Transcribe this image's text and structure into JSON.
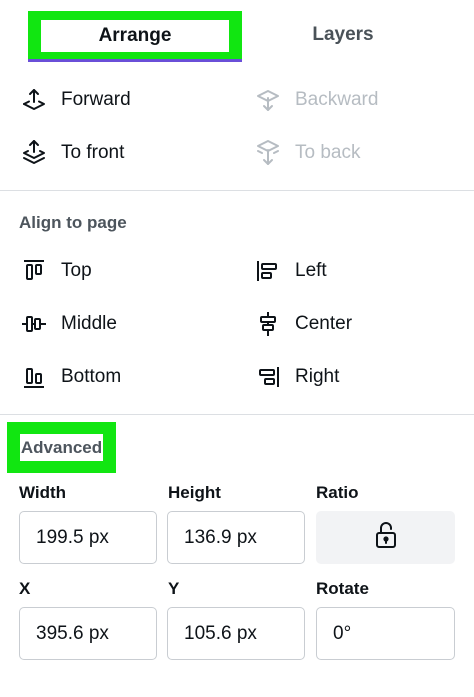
{
  "tabs": [
    {
      "label": "Arrange"
    },
    {
      "label": "Layers"
    }
  ],
  "order": {
    "forward": "Forward",
    "backward": "Backward",
    "to_front": "To front",
    "to_back": "To back"
  },
  "align": {
    "section_label": "Align to page",
    "top": "Top",
    "left": "Left",
    "middle": "Middle",
    "center": "Center",
    "bottom": "Bottom",
    "right": "Right"
  },
  "advanced": {
    "section_label": "Advanced",
    "width": {
      "label": "Width",
      "value": "199.5 px"
    },
    "height": {
      "label": "Height",
      "value": "136.9 px"
    },
    "ratio": {
      "label": "Ratio",
      "icon": "lock-open-icon"
    },
    "x": {
      "label": "X",
      "value": "395.6 px"
    },
    "y": {
      "label": "Y",
      "value": "105.6 px"
    },
    "rotate": {
      "label": "Rotate",
      "value": "0°"
    }
  },
  "colors": {
    "highlight": "#11e611",
    "active_tab_underline": "#6a4fd8",
    "disabled_text": "#b6bcc2"
  }
}
